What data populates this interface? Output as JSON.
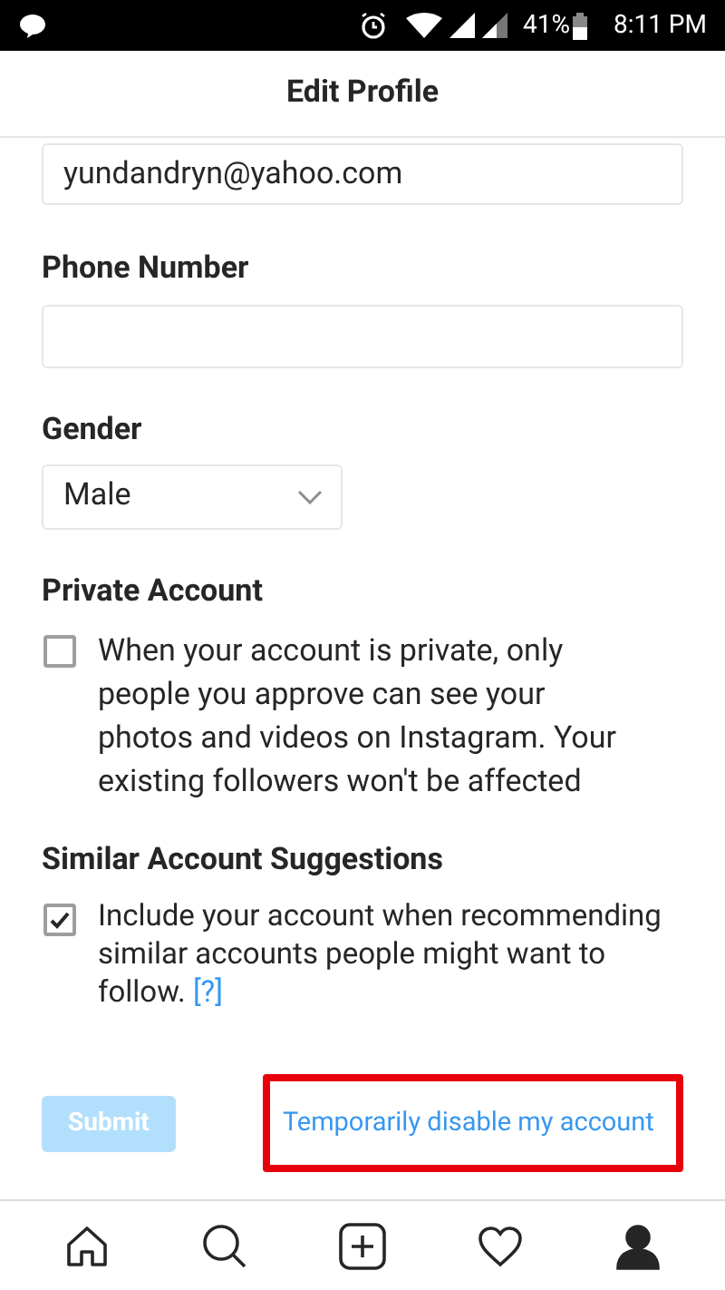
{
  "status_bar": {
    "battery": "41%",
    "time": "8:11 PM"
  },
  "header": {
    "title": "Edit Profile"
  },
  "email": {
    "value": "yundandryn@yahoo.com"
  },
  "phone": {
    "label": "Phone Number"
  },
  "gender": {
    "label": "Gender",
    "value": "Male"
  },
  "private_account": {
    "label": "Private Account",
    "checked": false,
    "text": "When your account is private, only people you approve can see your photos and videos on Instagram. Your existing followers won't be affected"
  },
  "similar_suggestions": {
    "label": "Similar Account Suggestions",
    "checked": true,
    "text": "Include your account when recommending similar accounts people might want to follow.",
    "link": "[?]"
  },
  "submit": {
    "label": "Submit",
    "disabled": true
  },
  "disable_link": {
    "label": "Temporarily disable my account",
    "highlighted": true
  },
  "bottom_nav": [
    {
      "kind": "home",
      "selected": false
    },
    {
      "kind": "search",
      "selected": false
    },
    {
      "kind": "add",
      "selected": false
    },
    {
      "kind": "heart",
      "selected": false
    },
    {
      "kind": "profile",
      "selected": true
    }
  ]
}
